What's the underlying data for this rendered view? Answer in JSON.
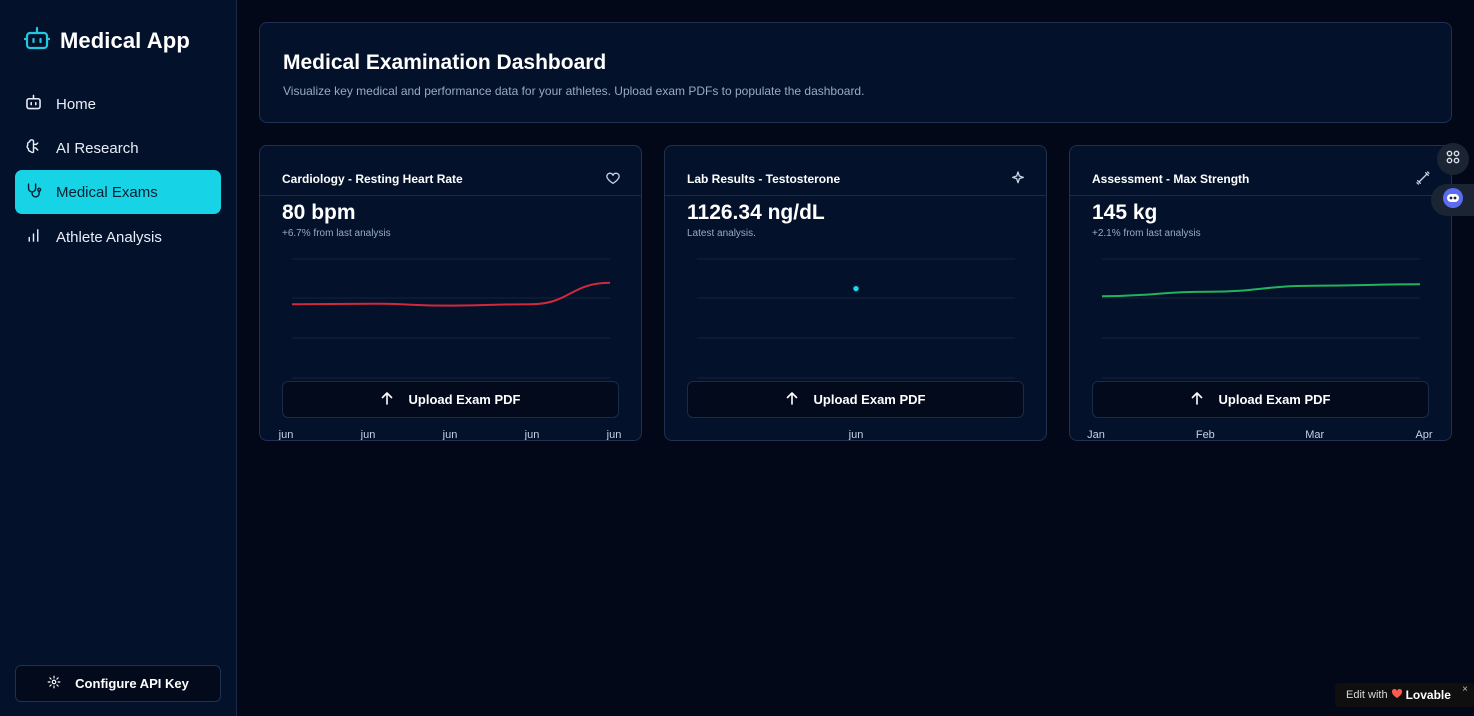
{
  "app": {
    "title": "Medical App"
  },
  "sidebar": {
    "items": [
      {
        "label": "Home",
        "icon": "bot-icon",
        "active": false
      },
      {
        "label": "AI Research",
        "icon": "brain-icon",
        "active": false
      },
      {
        "label": "Medical Exams",
        "icon": "stethoscope-icon",
        "active": true
      },
      {
        "label": "Athlete Analysis",
        "icon": "bar-chart-icon",
        "active": false
      }
    ],
    "configure_label": "Configure API Key"
  },
  "header": {
    "title": "Medical Examination Dashboard",
    "subtitle": "Visualize key medical and performance data for your athletes. Upload exam PDFs to populate the dashboard."
  },
  "cards": [
    {
      "title": "Cardiology - Resting Heart Rate",
      "value": "80 bpm",
      "sub": "+6.7% from last analysis",
      "icon": "heart-icon",
      "upload_label": "Upload Exam PDF",
      "line_color": "#d0283c",
      "chart_data": {
        "type": "line",
        "x": [
          "jun",
          "jun",
          "jun",
          "jun",
          "jun"
        ],
        "series": [
          {
            "values": [
              75.5,
              75.6,
              75.2,
              75.5,
              80
            ]
          }
        ],
        "ylim": [
          60,
          85
        ]
      }
    },
    {
      "title": "Lab Results - Testosterone",
      "value": "1126.34 ng/dL",
      "sub": "Latest analysis.",
      "icon": "sparkles-icon",
      "upload_label": "Upload Exam PDF",
      "line_color": "#1ed8ea",
      "chart_data": {
        "type": "scatter",
        "x": [
          "jun"
        ],
        "series": [
          {
            "values": [
              1126.34
            ]
          }
        ],
        "ylim": [
          0,
          1500
        ]
      }
    },
    {
      "title": "Assessment - Max Strength",
      "value": "145 kg",
      "sub": "+2.1% from last analysis",
      "icon": "dumbbell-icon",
      "upload_label": "Upload Exam PDF",
      "line_color": "#22b35e",
      "chart_data": {
        "type": "line",
        "x": [
          "Jan",
          "Feb",
          "Mar",
          "Apr"
        ],
        "series": [
          {
            "values": [
              135,
              138,
              142,
              143
            ]
          }
        ],
        "ylim": [
          80,
          160
        ]
      }
    }
  ],
  "lovable": {
    "prefix": "Edit with",
    "brand": "Lovable",
    "close": "×"
  }
}
